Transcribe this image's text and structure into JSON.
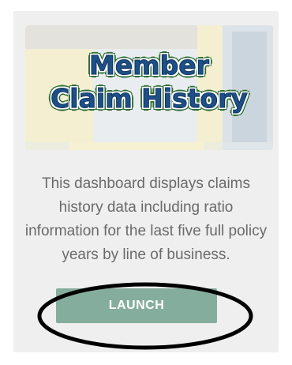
{
  "banner": {
    "title_line1": "Member",
    "title_line2": "Claim History"
  },
  "description": "This dashboard displays claims history data including ratio information for the last five full policy years by line of business.",
  "launch_button": {
    "label": "LAUNCH"
  },
  "colors": {
    "card_background": "#efefef",
    "button_background": "#85ad9d",
    "title_color": "#1e4f86",
    "annotation_ellipse": "#000000"
  }
}
